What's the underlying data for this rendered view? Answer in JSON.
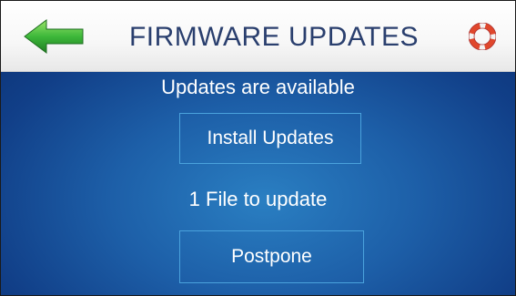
{
  "header": {
    "title": "FIRMWARE UPDATES",
    "back_icon": "back-arrow-icon",
    "help_icon": "lifebuoy-icon"
  },
  "main": {
    "status": "Updates are available",
    "install_label": "Install Updates",
    "file_count": "1 File to update",
    "postpone_label": "Postpone"
  },
  "colors": {
    "header_text": "#2a3f6e",
    "background_blue": "#1d5fa8",
    "button_border": "#4aa2dc",
    "arrow_green": "#3db83a",
    "lifebuoy_red": "#e0472c"
  }
}
